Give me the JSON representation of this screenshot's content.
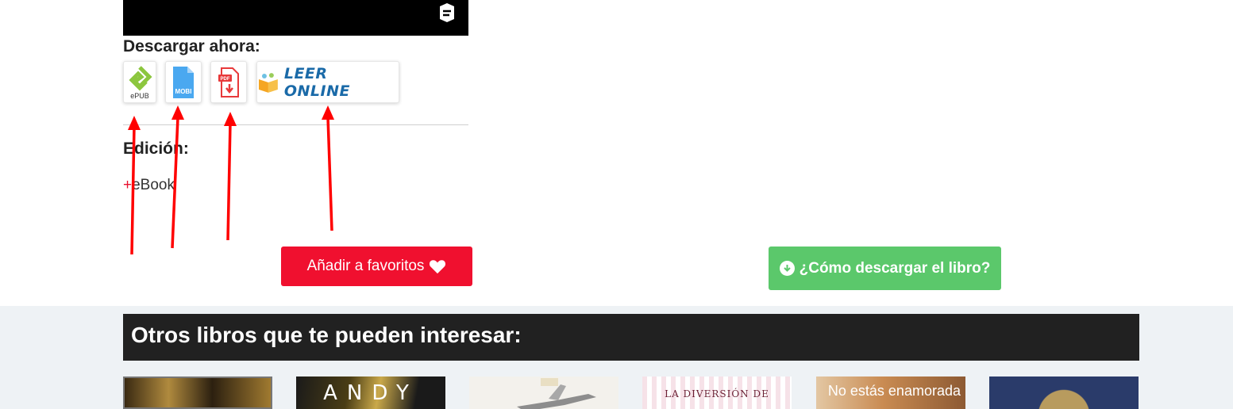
{
  "download": {
    "title": "Descargar ahora:",
    "formats": [
      {
        "label": "ePUB"
      },
      {
        "label": "MOBI"
      },
      {
        "label": "PDF"
      },
      {
        "label": "LEER ONLINE"
      }
    ]
  },
  "edition": {
    "title": "Edición:",
    "plus": "+",
    "item": "eBook"
  },
  "buttons": {
    "favorites": "Añadir a favoritos",
    "how_to_download": "¿Cómo descargar el libro?"
  },
  "related": {
    "title": "Otros libros que te pueden interesar:",
    "books": [
      {
        "cover_text": ""
      },
      {
        "cover_text": "ANDY"
      },
      {
        "cover_text": ""
      },
      {
        "cover_text": "LA DIVERSIÓN DE"
      },
      {
        "cover_text": "No estás enamorada"
      },
      {
        "cover_text": ""
      }
    ]
  },
  "colors": {
    "accent_red": "#f0102f",
    "download_green": "#5bc86b",
    "dark_bar": "#212121",
    "annotation_arrow": "#ff0000"
  }
}
